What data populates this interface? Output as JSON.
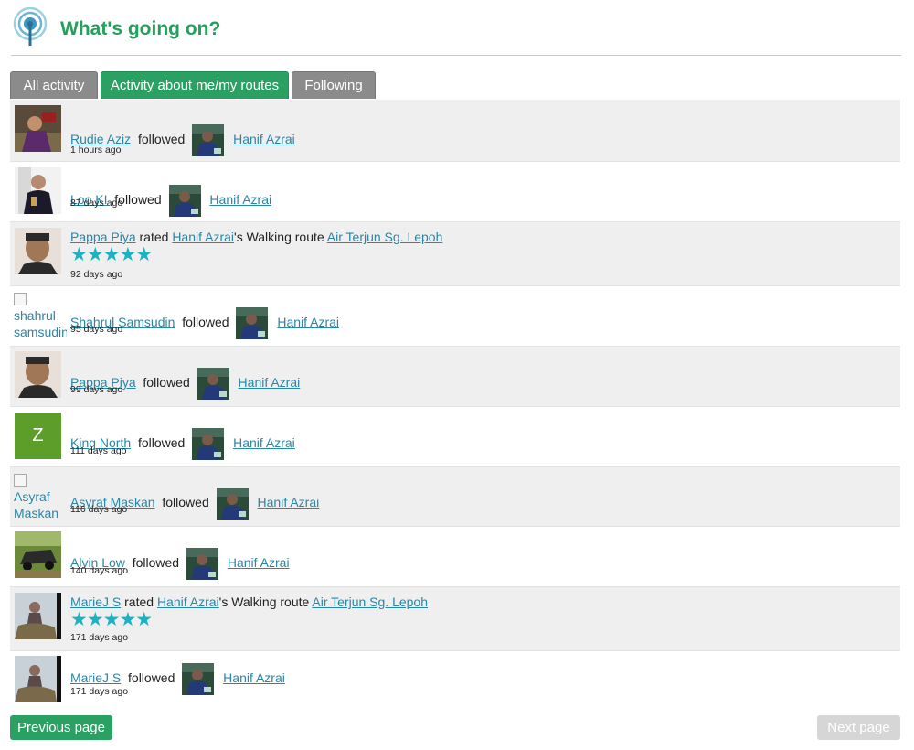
{
  "header": {
    "title": "What's going on?",
    "logo_icon": "broadcast-antenna-icon"
  },
  "tabs": [
    {
      "label": "All activity",
      "active": false
    },
    {
      "label": "Activity about me/my routes",
      "active": true
    },
    {
      "label": "Following",
      "active": false
    }
  ],
  "followed_text": "followed",
  "rated_text": "rated",
  "route_text": "'s Walking route",
  "target_name": "Hanif Azrai",
  "route_name": "Air Terjun Sg. Lepoh",
  "rating_stars": "★★★★★",
  "rating": 5,
  "activities": [
    {
      "user": "Rudie Aziz",
      "time": "1 hours ago"
    },
    {
      "user": "Loo KI",
      "time": "87 days ago"
    },
    {
      "user": "Pappa Piya",
      "time": "92 days ago"
    },
    {
      "user": "Shahrul Samsudin",
      "time": "95 days ago",
      "avatar_alt": "shahrul samsudin"
    },
    {
      "user": "Pappa Piya",
      "time": "99 days ago"
    },
    {
      "user": "King North",
      "time": "111 days ago",
      "avatar_letter": "Z"
    },
    {
      "user": "Asyraf Maskan",
      "time": "116 days ago",
      "avatar_alt": "Asyraf Maskan"
    },
    {
      "user": "Alvin Low",
      "time": "140 days ago"
    },
    {
      "user": "MarieJ S",
      "time": "171 days ago"
    },
    {
      "user": "MarieJ S",
      "time": "171 days ago"
    }
  ],
  "pagination": {
    "prev_label": "Previous page",
    "next_label": "Next page"
  },
  "colors": {
    "brand_green": "#2aa163",
    "link": "#2a86a7",
    "star": "#1bb2c4",
    "tab_inactive": "#8b8b8b"
  }
}
